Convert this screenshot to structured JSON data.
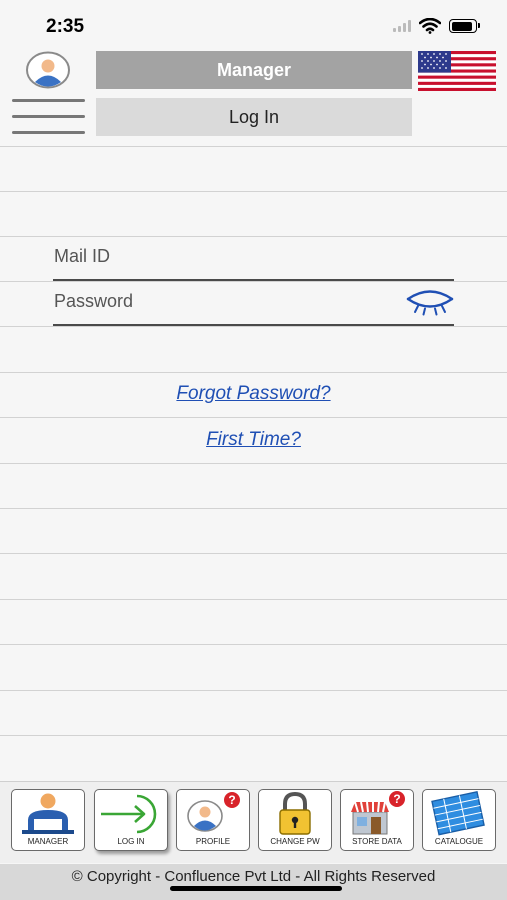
{
  "status_bar": {
    "time": "2:35",
    "battery_level": 0.9
  },
  "header": {
    "role_label": "Manager",
    "login_label": "Log In",
    "flag_icon": "us-flag-icon",
    "avatar_icon": "user-avatar-icon",
    "menu_icon": "hamburger-menu-icon"
  },
  "form": {
    "mail_label": "Mail ID",
    "password_label": "Password",
    "eye_icon": "eye-closed-icon"
  },
  "links": {
    "forgot_password": "Forgot Password?",
    "first_time": "First Time?"
  },
  "bottom_nav": {
    "items": [
      {
        "label": "MANAGER",
        "icon": "manager-icon"
      },
      {
        "label": "LOG IN",
        "icon": "login-arrow-icon"
      },
      {
        "label": "PROFILE",
        "icon": "profile-question-icon"
      },
      {
        "label": "CHANGE PW",
        "icon": "padlock-icon"
      },
      {
        "label": "STORE DATA",
        "icon": "store-icon"
      },
      {
        "label": "CATALOGUE",
        "icon": "catalogue-icon"
      }
    ]
  },
  "footer": {
    "copyright": "© Copyright - Confluence Pvt Ltd - All Rights Reserved"
  },
  "colors": {
    "link": "#1f4fb4",
    "role_bar": "#a3a3a3",
    "login_bar": "#dadada",
    "eye": "#1f4fb4"
  }
}
